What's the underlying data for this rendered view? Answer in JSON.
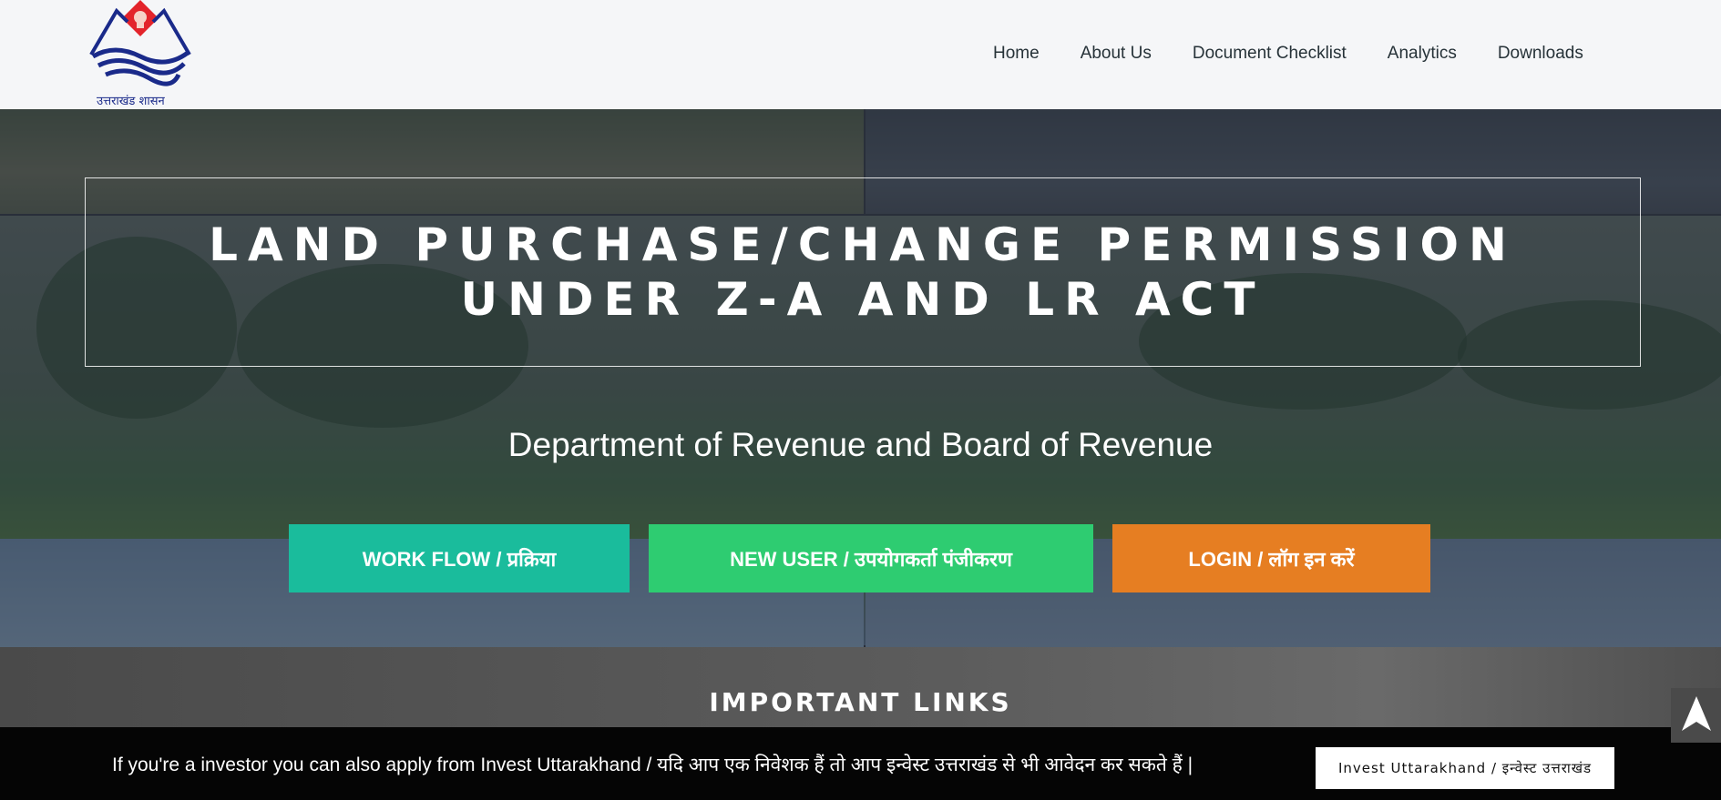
{
  "header": {
    "logo_caption": "उत्तराखंड शासन",
    "nav": [
      "Home",
      "About Us",
      "Document Checklist",
      "Analytics",
      "Downloads"
    ]
  },
  "hero": {
    "title_line1": "LAND PURCHASE/CHANGE PERMISSION",
    "title_line2": "UNDER Z-A AND LR ACT",
    "subtitle": "Department of Revenue and Board of Revenue",
    "buttons": {
      "workflow": "WORK FLOW / प्रक्रिया",
      "new_user": "NEW USER / उपयोगकर्ता पंजीकरण",
      "login": "LOGIN / लॉग इन करें"
    }
  },
  "links": {
    "title": "IMPORTANT LINKS"
  },
  "bottom_bar": {
    "text": "If you're a investor you can also apply from Invest Uttarakhand / यदि आप एक निवेशक हैं तो आप इन्वेस्ट उत्तराखंड से भी आवेदन कर सकते हैं |",
    "button": "Invest Uttarakhand / इन्वेस्ट उत्तराखंड"
  },
  "icons": {
    "logo": "uttarakhand-emblem-icon",
    "scroll_top": "arrow-up-icon"
  },
  "colors": {
    "workflow": "#1abc9c",
    "new_user": "#2ecc71",
    "login": "#e67e22",
    "logo_red": "#e3242b",
    "logo_blue": "#1a2a8a"
  }
}
